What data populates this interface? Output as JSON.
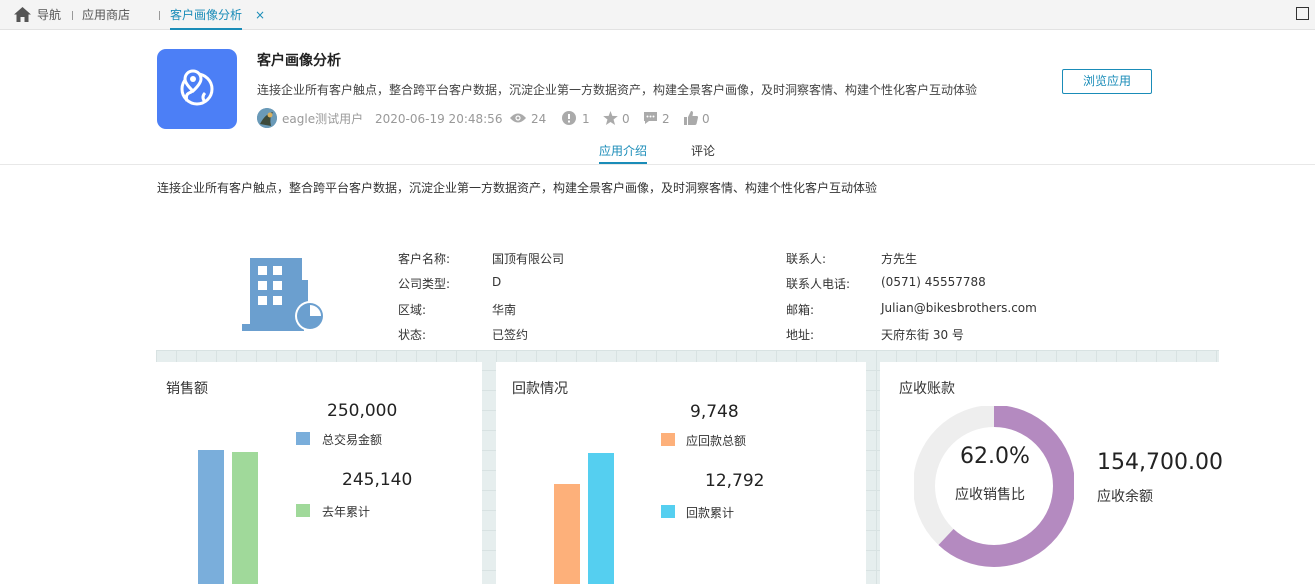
{
  "tabs": {
    "home_label": "导航",
    "store_label": "应用商店",
    "active_label": "客户画像分析",
    "close_glyph": "×"
  },
  "app": {
    "title": "客户画像分析",
    "description": "连接企业所有客户触点，整合跨平台客户数据，沉淀企业第一方数据资产，构建全景客户画像，及时洞察客情、构建个性化客户互动体验",
    "author": "eagle测试用户",
    "datetime": "2020-06-19 20:48:56",
    "views": "24",
    "downloads": "1",
    "stars": "0",
    "comments": "2",
    "likes": "0",
    "browse_label": "浏览应用",
    "icon_color": "#4c7ff6"
  },
  "subtabs": {
    "intro_label": "应用介绍",
    "comment_label": "评论"
  },
  "intro_text": "连接企业所有客户触点，整合跨平台客户数据，沉淀企业第一方数据资产，构建全景客户画像，及时洞察客情、构建个性化客户互动体验",
  "customer": {
    "name_label": "客户名称:",
    "name": "国顶有限公司",
    "type_label": "公司类型:",
    "type": "D",
    "region_label": "区域:",
    "region": "华南",
    "status_label": "状态:",
    "status": "已签约",
    "contact_label": "联系人:",
    "contact": "方先生",
    "phone_label": "联系人电话:",
    "phone": "(0571) 45557788",
    "email_label": "邮箱:",
    "email": "Julian@bikesbrothers.com",
    "address_label": "地址:",
    "address": "天府东街 30 号"
  },
  "chart_data": [
    {
      "type": "bar",
      "title": "销售额",
      "series": [
        {
          "name": "总交易金额",
          "value": 250000,
          "label": "250,000",
          "color": "#7aaedb"
        },
        {
          "name": "去年累计",
          "value": 245140,
          "label": "245,140",
          "color": "#a0d99a"
        }
      ],
      "ylim": [
        0,
        300000
      ]
    },
    {
      "type": "bar",
      "title": "回款情况",
      "series": [
        {
          "name": "应回款总额",
          "value": 9748,
          "label": "9,748",
          "color": "#fdb07a"
        },
        {
          "name": "回款累计",
          "value": 12792,
          "label": "12,792",
          "color": "#55cff0"
        }
      ],
      "ylim": [
        0,
        16000
      ]
    },
    {
      "type": "pie",
      "title": "应收账款",
      "percent": 62.0,
      "percent_label": "62.0%",
      "center_label": "应收销售比",
      "amount": "154,700.00",
      "amount_label": "应收余额",
      "colors": {
        "filled": "#b48ac0",
        "remaining": "#eeeeee"
      }
    }
  ]
}
